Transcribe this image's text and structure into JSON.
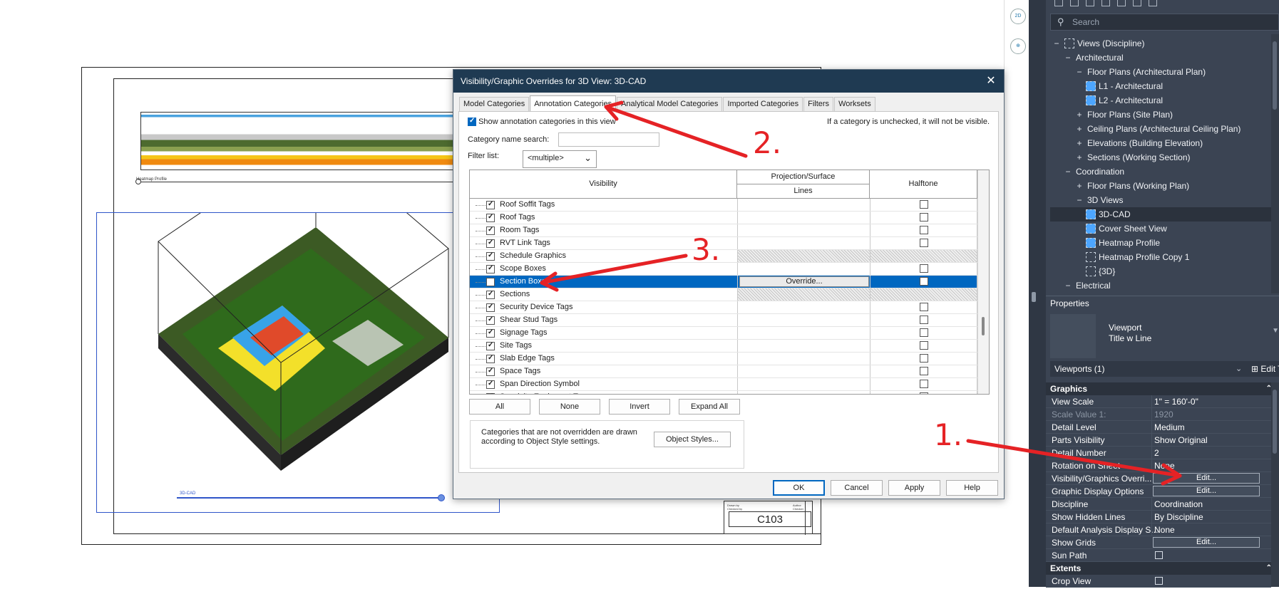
{
  "canvas": {
    "heatmap_vp_title": "Heatmap Profile",
    "cad_vp_title": "3D-CAD",
    "sheet_number": "C103",
    "tb_drawn_by": "Drawn by",
    "tb_drawn_val": "Author",
    "tb_checked_by": "Checked by",
    "tb_checked_val": "Checker",
    "tb_scale": "Scale",
    "viewcube_2d": "2D"
  },
  "dialog": {
    "title": "Visibility/Graphic Overrides for 3D View: 3D-CAD",
    "close": "✕",
    "tabs": [
      "Model Categories",
      "Annotation Categories",
      "Analytical Model Categories",
      "Imported Categories",
      "Filters",
      "Worksets"
    ],
    "active_tab": 1,
    "show_categories_label": "Show annotation categories in this view",
    "unchecked_note": "If a category is unchecked, it will not be visible.",
    "category_search_label": "Category name search:",
    "category_search_value": "",
    "filter_list_label": "Filter list:",
    "filter_list_value": "<multiple>",
    "columns": {
      "visibility": "Visibility",
      "projection_surface": "Projection/Surface",
      "lines": "Lines",
      "halftone": "Halftone"
    },
    "rows": [
      {
        "name": "Roof Soffit Tags",
        "checked": true,
        "halftone": false,
        "hatched": false
      },
      {
        "name": "Roof Tags",
        "checked": true,
        "halftone": false,
        "hatched": false
      },
      {
        "name": "Room Tags",
        "checked": true,
        "halftone": false,
        "hatched": false
      },
      {
        "name": "RVT Link Tags",
        "checked": true,
        "halftone": false,
        "hatched": false
      },
      {
        "name": "Schedule Graphics",
        "checked": true,
        "halftone": false,
        "hatched": true
      },
      {
        "name": "Scope Boxes",
        "checked": true,
        "halftone": false,
        "hatched": false
      },
      {
        "name": "Section Boxes",
        "checked": false,
        "halftone": false,
        "hatched": false,
        "selected": true
      },
      {
        "name": "Sections",
        "checked": true,
        "halftone": false,
        "hatched": true
      },
      {
        "name": "Security Device Tags",
        "checked": true,
        "halftone": false,
        "hatched": false
      },
      {
        "name": "Shear Stud Tags",
        "checked": true,
        "halftone": false,
        "hatched": false
      },
      {
        "name": "Signage Tags",
        "checked": true,
        "halftone": false,
        "hatched": false
      },
      {
        "name": "Site Tags",
        "checked": true,
        "halftone": false,
        "hatched": false
      },
      {
        "name": "Slab Edge Tags",
        "checked": true,
        "halftone": false,
        "hatched": false
      },
      {
        "name": "Space Tags",
        "checked": true,
        "halftone": false,
        "hatched": false
      },
      {
        "name": "Span Direction Symbol",
        "checked": true,
        "halftone": false,
        "hatched": false
      },
      {
        "name": "Specialty Equipment Tags",
        "checked": true,
        "halftone": false,
        "hatched": false
      }
    ],
    "override_button": "Override...",
    "buttons": {
      "all": "All",
      "none": "None",
      "invert": "Invert",
      "expand_all": "Expand All",
      "object_styles": "Object Styles...",
      "ok": "OK",
      "cancel": "Cancel",
      "apply": "Apply",
      "help": "Help"
    },
    "note": "Categories that are not overridden are drawn according to Object Style settings."
  },
  "project_browser": {
    "search_placeholder": "Search",
    "items": [
      {
        "label": "Views (Discipline)",
        "level": 0,
        "exp": "−",
        "icon": "plain"
      },
      {
        "label": "Architectural",
        "level": 1,
        "exp": "−"
      },
      {
        "label": "Floor Plans (Architectural Plan)",
        "level": 2,
        "exp": "−"
      },
      {
        "label": "L1 - Architectural",
        "level": 3,
        "icon": "blue"
      },
      {
        "label": "L2 - Architectural",
        "level": 3,
        "icon": "blue"
      },
      {
        "label": "Floor Plans (Site Plan)",
        "level": 2,
        "exp": "+"
      },
      {
        "label": "Ceiling Plans (Architectural Ceiling Plan)",
        "level": 2,
        "exp": "+"
      },
      {
        "label": "Elevations (Building Elevation)",
        "level": 2,
        "exp": "+"
      },
      {
        "label": "Sections (Working Section)",
        "level": 2,
        "exp": "+"
      },
      {
        "label": "Coordination",
        "level": 1,
        "exp": "−"
      },
      {
        "label": "Floor Plans (Working Plan)",
        "level": 2,
        "exp": "+"
      },
      {
        "label": "3D Views",
        "level": 2,
        "exp": "−"
      },
      {
        "label": "3D-CAD",
        "level": 3,
        "icon": "blue",
        "selected": true
      },
      {
        "label": "Cover Sheet View",
        "level": 3,
        "icon": "blue"
      },
      {
        "label": "Heatmap Profile",
        "level": 3,
        "icon": "blue"
      },
      {
        "label": "Heatmap Profile Copy 1",
        "level": 3,
        "icon": "plain"
      },
      {
        "label": "{3D}",
        "level": 3,
        "icon": "plain"
      },
      {
        "label": "Electrical",
        "level": 1,
        "exp": "−"
      }
    ]
  },
  "properties": {
    "header": "Properties",
    "type_name_1": "Viewport",
    "type_name_2": "Title w Line",
    "instance_label": "Viewports (1)",
    "edit_type": "Edit Type",
    "groups": {
      "graphics": "Graphics",
      "extents": "Extents"
    },
    "rows": [
      {
        "key": "View Scale",
        "val": "1\" = 160'-0\""
      },
      {
        "key": "Scale Value    1:",
        "val": "1920",
        "dim": true
      },
      {
        "key": "Detail Level",
        "val": "Medium"
      },
      {
        "key": "Parts Visibility",
        "val": "Show Original"
      },
      {
        "key": "Detail Number",
        "val": "2"
      },
      {
        "key": "Rotation on Sheet",
        "val": "None"
      },
      {
        "key": "Visibility/Graphics Overri...",
        "button": "Edit..."
      },
      {
        "key": "Graphic Display Options",
        "button": "Edit..."
      },
      {
        "key": "Discipline",
        "val": "Coordination"
      },
      {
        "key": "Show Hidden Lines",
        "val": "By Discipline"
      },
      {
        "key": "Default Analysis Display S...",
        "val": "None"
      },
      {
        "key": "Show Grids",
        "button": "Edit..."
      },
      {
        "key": "Sun Path",
        "checkbox": true
      }
    ],
    "extents_rows": [
      {
        "key": "Crop View",
        "checkbox": true
      }
    ]
  },
  "annotations": {
    "step1": "1.",
    "step2": "2.",
    "step3": "3.",
    "color": "#e52225"
  }
}
